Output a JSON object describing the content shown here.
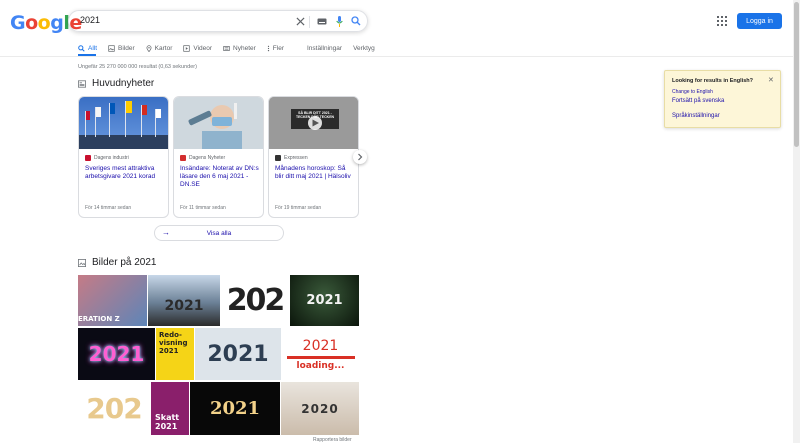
{
  "logo": {
    "letters": [
      "G",
      "o",
      "o",
      "g",
      "l",
      "e"
    ],
    "colors": [
      "#4285f4",
      "#ea4335",
      "#fbbc05",
      "#4285f4",
      "#34a853",
      "#ea4335"
    ]
  },
  "search": {
    "query": "2021"
  },
  "header": {
    "login_label": "Logga in"
  },
  "tabs": [
    {
      "label": "Allt",
      "icon": "search-icon",
      "active": true
    },
    {
      "label": "Bilder",
      "icon": "image-icon"
    },
    {
      "label": "Kartor",
      "icon": "map-pin-icon"
    },
    {
      "label": "Videor",
      "icon": "video-icon"
    },
    {
      "label": "Nyheter",
      "icon": "news-icon"
    },
    {
      "label": "Fler",
      "icon": "more-icon"
    },
    {
      "label": "Inställningar"
    },
    {
      "label": "Verktyg"
    }
  ],
  "results": {
    "stats": "Ungefär 25 270 000 000 resultat (0,63 sekunder)"
  },
  "news": {
    "heading": "Huvudnyheter",
    "view_all": "Visa alla",
    "cards": [
      {
        "source": "Dagens industri",
        "title": "Sveriges mest attraktiva arbetsgivare 2021 korad",
        "time": "För 14 timmar sedan",
        "fav_color": "#c8102e"
      },
      {
        "source": "Dagens Nyheter",
        "title": "Insändare: Noterat av DN:s läsare den 6 maj 2021 - DN.SE",
        "time": "För 11 timmar sedan",
        "fav_color": "#d32f2f"
      },
      {
        "source": "Expressen",
        "title": "Månadens horoskop: Så blir ditt maj 2021 | Hälsoliv",
        "time": "För 19 timmar sedan",
        "fav_color": "#333333"
      }
    ],
    "card3_image_text": "SÅ BLIR DITT 2021 - TECKEN FÖR TECKEN"
  },
  "images": {
    "heading": "Bilder på 2021",
    "report": "Rapportera bilder",
    "tile_texts": {
      "t1": "ERATION Z",
      "t2": "2021",
      "t3": "202",
      "t4": "2021",
      "t5": "2021",
      "t6": "Redo-visning 2021",
      "t7": "2021",
      "t8a": "2021",
      "t8b": "loading...",
      "t9": "202",
      "t10": "Skatt 2021",
      "t11": "2021",
      "t12": "2020"
    }
  },
  "english_prompt": {
    "title": "Looking for results in English?",
    "change": "Change to English",
    "continue": "Fortsätt på svenska",
    "settings": "Språkinställningar"
  }
}
